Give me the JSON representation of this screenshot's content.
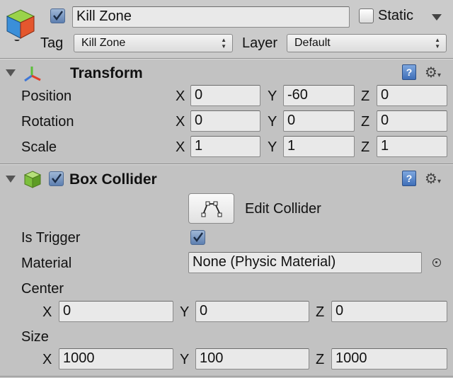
{
  "header": {
    "active": true,
    "name": "Kill Zone",
    "static_label": "Static",
    "static_checked": false,
    "tag_label": "Tag",
    "tag_value": "Kill Zone",
    "layer_label": "Layer",
    "layer_value": "Default"
  },
  "transform": {
    "title": "Transform",
    "rows": [
      {
        "label": "Position",
        "x": "0",
        "y": "-60",
        "z": "0"
      },
      {
        "label": "Rotation",
        "x": "0",
        "y": "0",
        "z": "0"
      },
      {
        "label": "Scale",
        "x": "1",
        "y": "1",
        "z": "1"
      }
    ]
  },
  "box_collider": {
    "title": "Box Collider",
    "enabled": true,
    "edit_collider_label": "Edit Collider",
    "is_trigger_label": "Is Trigger",
    "is_trigger": true,
    "material_label": "Material",
    "material_value": "None (Physic Material)",
    "center_label": "Center",
    "center": {
      "x": "0",
      "y": "0",
      "z": "0"
    },
    "size_label": "Size",
    "size": {
      "x": "1000",
      "y": "100",
      "z": "1000"
    }
  },
  "axes": {
    "x": "X",
    "y": "Y",
    "z": "Z"
  },
  "icons": {
    "gameobject": "cube-icon",
    "transform": "transform-axes-icon",
    "collider": "box-collider-icon",
    "help": "help-book-icon",
    "settings": "gear-icon",
    "object_picker": "object-picker-icon",
    "edit_collider": "edit-collider-icon"
  }
}
